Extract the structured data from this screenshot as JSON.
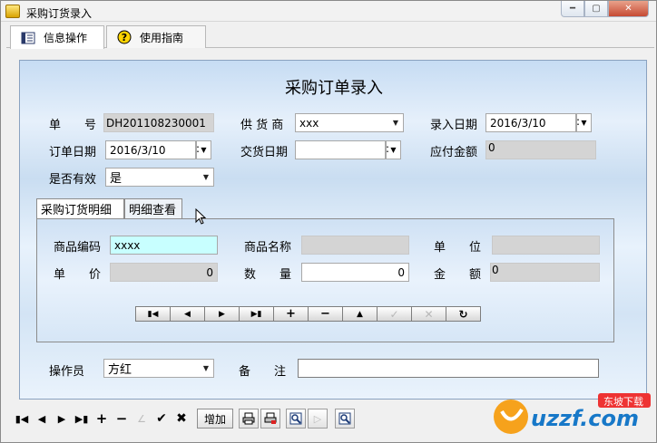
{
  "window": {
    "title": "采购订货录入"
  },
  "tabs": [
    {
      "label": "信息操作",
      "icon": "list-icon"
    },
    {
      "label": "使用指南",
      "icon": "help-icon"
    }
  ],
  "form": {
    "title": "采购订单录入",
    "order_no": {
      "label": "单　　号",
      "value": "DH201108230001"
    },
    "supplier": {
      "label": "供 货 商",
      "value": "xxx"
    },
    "entry_date": {
      "label": "录入日期",
      "value": "2016/3/10"
    },
    "order_date": {
      "label": "订单日期",
      "value": "2016/3/10"
    },
    "delivery_date": {
      "label": "交货日期",
      "value": ""
    },
    "payable": {
      "label": "应付金额",
      "value": "0"
    },
    "valid": {
      "label": "是否有效",
      "value": "是"
    }
  },
  "detail_tabs": [
    {
      "label": "采购订货明细"
    },
    {
      "label": "明细查看"
    }
  ],
  "detail": {
    "product_code": {
      "label": "商品编码",
      "value": "xxxx"
    },
    "product_name": {
      "label": "商品名称",
      "value": ""
    },
    "unit": {
      "label": "单　　位",
      "value": ""
    },
    "price": {
      "label": "单　　价",
      "value": "0"
    },
    "qty": {
      "label": "数　　量",
      "value": "0"
    },
    "amount": {
      "label": "金　　额",
      "value": "0"
    }
  },
  "operator": {
    "label": "操作员",
    "value": "方红"
  },
  "remark": {
    "label": "备　　注",
    "value": ""
  },
  "statusbar": {
    "add_label": "增加"
  },
  "watermark": {
    "text": "uzzf.com",
    "tagline": "东坡下载"
  }
}
